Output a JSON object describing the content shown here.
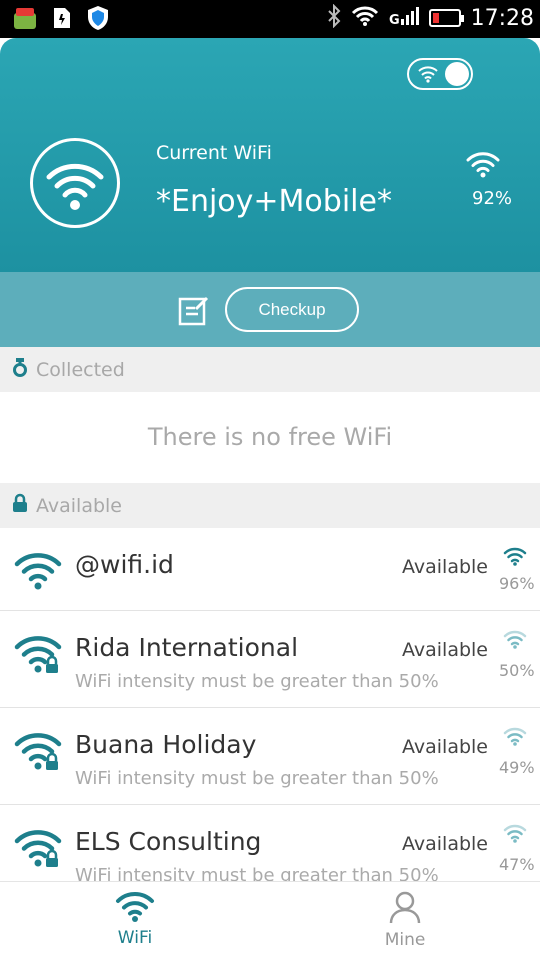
{
  "status_bar": {
    "time": "17:28"
  },
  "header": {
    "current_label": "Current WiFi",
    "current_name": "*Enjoy+Mobile*",
    "signal_percent": "92%",
    "checkup_label": "Checkup"
  },
  "collected": {
    "title": "Collected",
    "empty_message": "There is no free WiFi"
  },
  "available": {
    "title": "Available",
    "networks": [
      {
        "name": "@wifi.id",
        "status": "Available",
        "signal": "96%",
        "note": "",
        "locked": false
      },
      {
        "name": "Rida International",
        "status": "Available",
        "signal": "50%",
        "note": "WiFi intensity must be greater than 50%",
        "locked": true
      },
      {
        "name": "Buana Holiday",
        "status": "Available",
        "signal": "49%",
        "note": "WiFi intensity must be greater than 50%",
        "locked": true
      },
      {
        "name": "ELS Consulting",
        "status": "Available",
        "signal": "47%",
        "note": "WiFi intensity must be greater than 50%",
        "locked": true
      }
    ]
  },
  "bottom_nav": {
    "items": [
      {
        "label": "WiFi",
        "active": true
      },
      {
        "label": "Mine",
        "active": false
      }
    ]
  },
  "colors": {
    "accent": "#1e7f8c",
    "header": "#2ba6b4",
    "checkbar": "#5daebb"
  }
}
